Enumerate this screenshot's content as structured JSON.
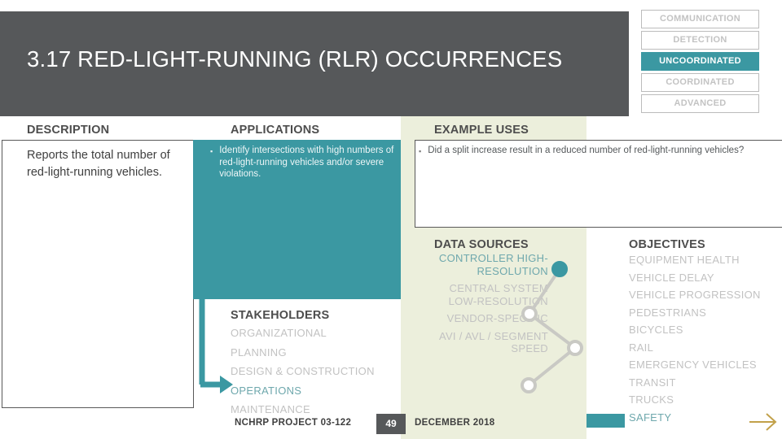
{
  "header": {
    "title": "3.17 RED-LIGHT-RUNNING (RLR) OCCURRENCES",
    "band_color": "#56585A"
  },
  "phase_badges": {
    "active_color": "#3B98A2",
    "inactive_color": "#C3C3C3",
    "items": [
      {
        "label": "COMMUNICATION",
        "active": false
      },
      {
        "label": "DETECTION",
        "active": false
      },
      {
        "label": "UNCOORDINATED",
        "active": true
      },
      {
        "label": "COORDINATED",
        "active": false
      },
      {
        "label": "ADVANCED",
        "active": false
      }
    ]
  },
  "description": {
    "heading": "DESCRIPTION",
    "body": "Reports the total number of red-light-running vehicles."
  },
  "applications": {
    "heading": "APPLICATIONS",
    "panel_color": "#3B98A2",
    "bullets": [
      "Identify intersections with high numbers of red-light-running vehicles and/or severe violations."
    ]
  },
  "example_uses": {
    "heading": "EXAMPLE USES",
    "bullets": [
      "Did a split increase result in a reduced number of red-light-running vehicles?"
    ]
  },
  "data_sources": {
    "heading": "DATA SOURCES",
    "items": [
      {
        "label": "CONTROLLER HIGH-RESOLUTION",
        "active": true
      },
      {
        "label": "CENTRAL SYSTEM LOW-RESOLUTION",
        "active": false
      },
      {
        "label": "VENDOR-SPECIFIC",
        "active": false
      },
      {
        "label": "AVI / AVL / SEGMENT SPEED",
        "active": false
      }
    ]
  },
  "objectives": {
    "heading": "OBJECTIVES",
    "items": [
      {
        "label": "EQUIPMENT HEALTH",
        "active": false
      },
      {
        "label": "VEHICLE DELAY",
        "active": false
      },
      {
        "label": "VEHICLE PROGRESSION",
        "active": false
      },
      {
        "label": "PEDESTRIANS",
        "active": false
      },
      {
        "label": "BICYCLES",
        "active": false
      },
      {
        "label": "RAIL",
        "active": false
      },
      {
        "label": "EMERGENCY VEHICLES",
        "active": false
      },
      {
        "label": "TRANSIT",
        "active": false
      },
      {
        "label": "TRUCKS",
        "active": false
      },
      {
        "label": "SAFETY",
        "active": true
      }
    ]
  },
  "stakeholders": {
    "heading": "STAKEHOLDERS",
    "items": [
      {
        "label": "ORGANIZATIONAL",
        "active": false
      },
      {
        "label": "PLANNING",
        "active": false
      },
      {
        "label": "DESIGN & CONSTRUCTION",
        "active": false
      },
      {
        "label": "OPERATIONS",
        "active": true
      },
      {
        "label": "MAINTENANCE",
        "active": false
      }
    ]
  },
  "footer": {
    "project": "NCHRP PROJECT 03-122",
    "page_number": "49",
    "date": "DECEMBER 2018"
  },
  "icons": {
    "bullet": "▪",
    "next_arrow": "next-arrow-icon"
  }
}
